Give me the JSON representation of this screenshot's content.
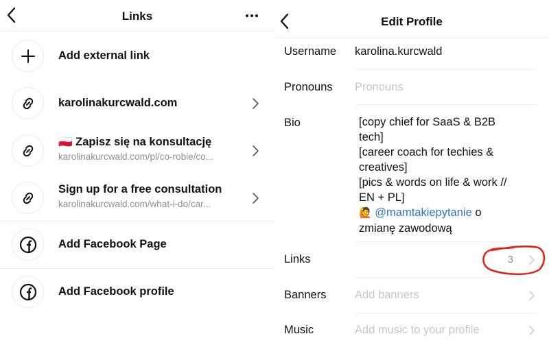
{
  "links_screen": {
    "title": "Links",
    "back_icon": "chevron-left-icon",
    "more_icon": "ellipsis-icon",
    "add_external": {
      "label": "Add external link",
      "icon": "plus-icon"
    },
    "items": [
      {
        "title": "karolinakurcwald.com",
        "url": "",
        "icon": "link-icon"
      },
      {
        "flag": "🇵🇱",
        "title": "Zapisz się na konsultację",
        "url": "karolinakurcwald.com/pl/co-robie/co...",
        "icon": "link-icon"
      },
      {
        "title": "Sign up for a free consultation",
        "url": "karolinakurcwald.com/what-i-do/car...",
        "icon": "link-icon"
      }
    ],
    "facebook_page": {
      "label": "Add Facebook Page",
      "icon": "facebook-icon"
    },
    "facebook_profile": {
      "label": "Add Facebook profile",
      "icon": "facebook-icon"
    }
  },
  "edit_profile": {
    "title": "Edit Profile",
    "back_icon": "chevron-left-icon",
    "fields": {
      "username": {
        "label": "Username",
        "value": "karolina.kurcwald"
      },
      "pronouns": {
        "label": "Pronouns",
        "placeholder": "Pronouns"
      },
      "bio": {
        "label": "Bio",
        "lines": [
          "[copy chief for SaaS & B2B",
          "tech]",
          "[career coach for techies &",
          "creatives]",
          "[pics & words on life & work //",
          "EN + PL]"
        ],
        "emoji": "🙋",
        "mention": "@mamtakiepytanie",
        "after_mention": " o",
        "last_line": "zmianę zawodową"
      },
      "links": {
        "label": "Links",
        "count": "3"
      },
      "banners": {
        "label": "Banners",
        "placeholder": "Add banners"
      },
      "music": {
        "label": "Music",
        "placeholder": "Add music to your profile"
      }
    },
    "annotation_color": "#e0261b"
  }
}
